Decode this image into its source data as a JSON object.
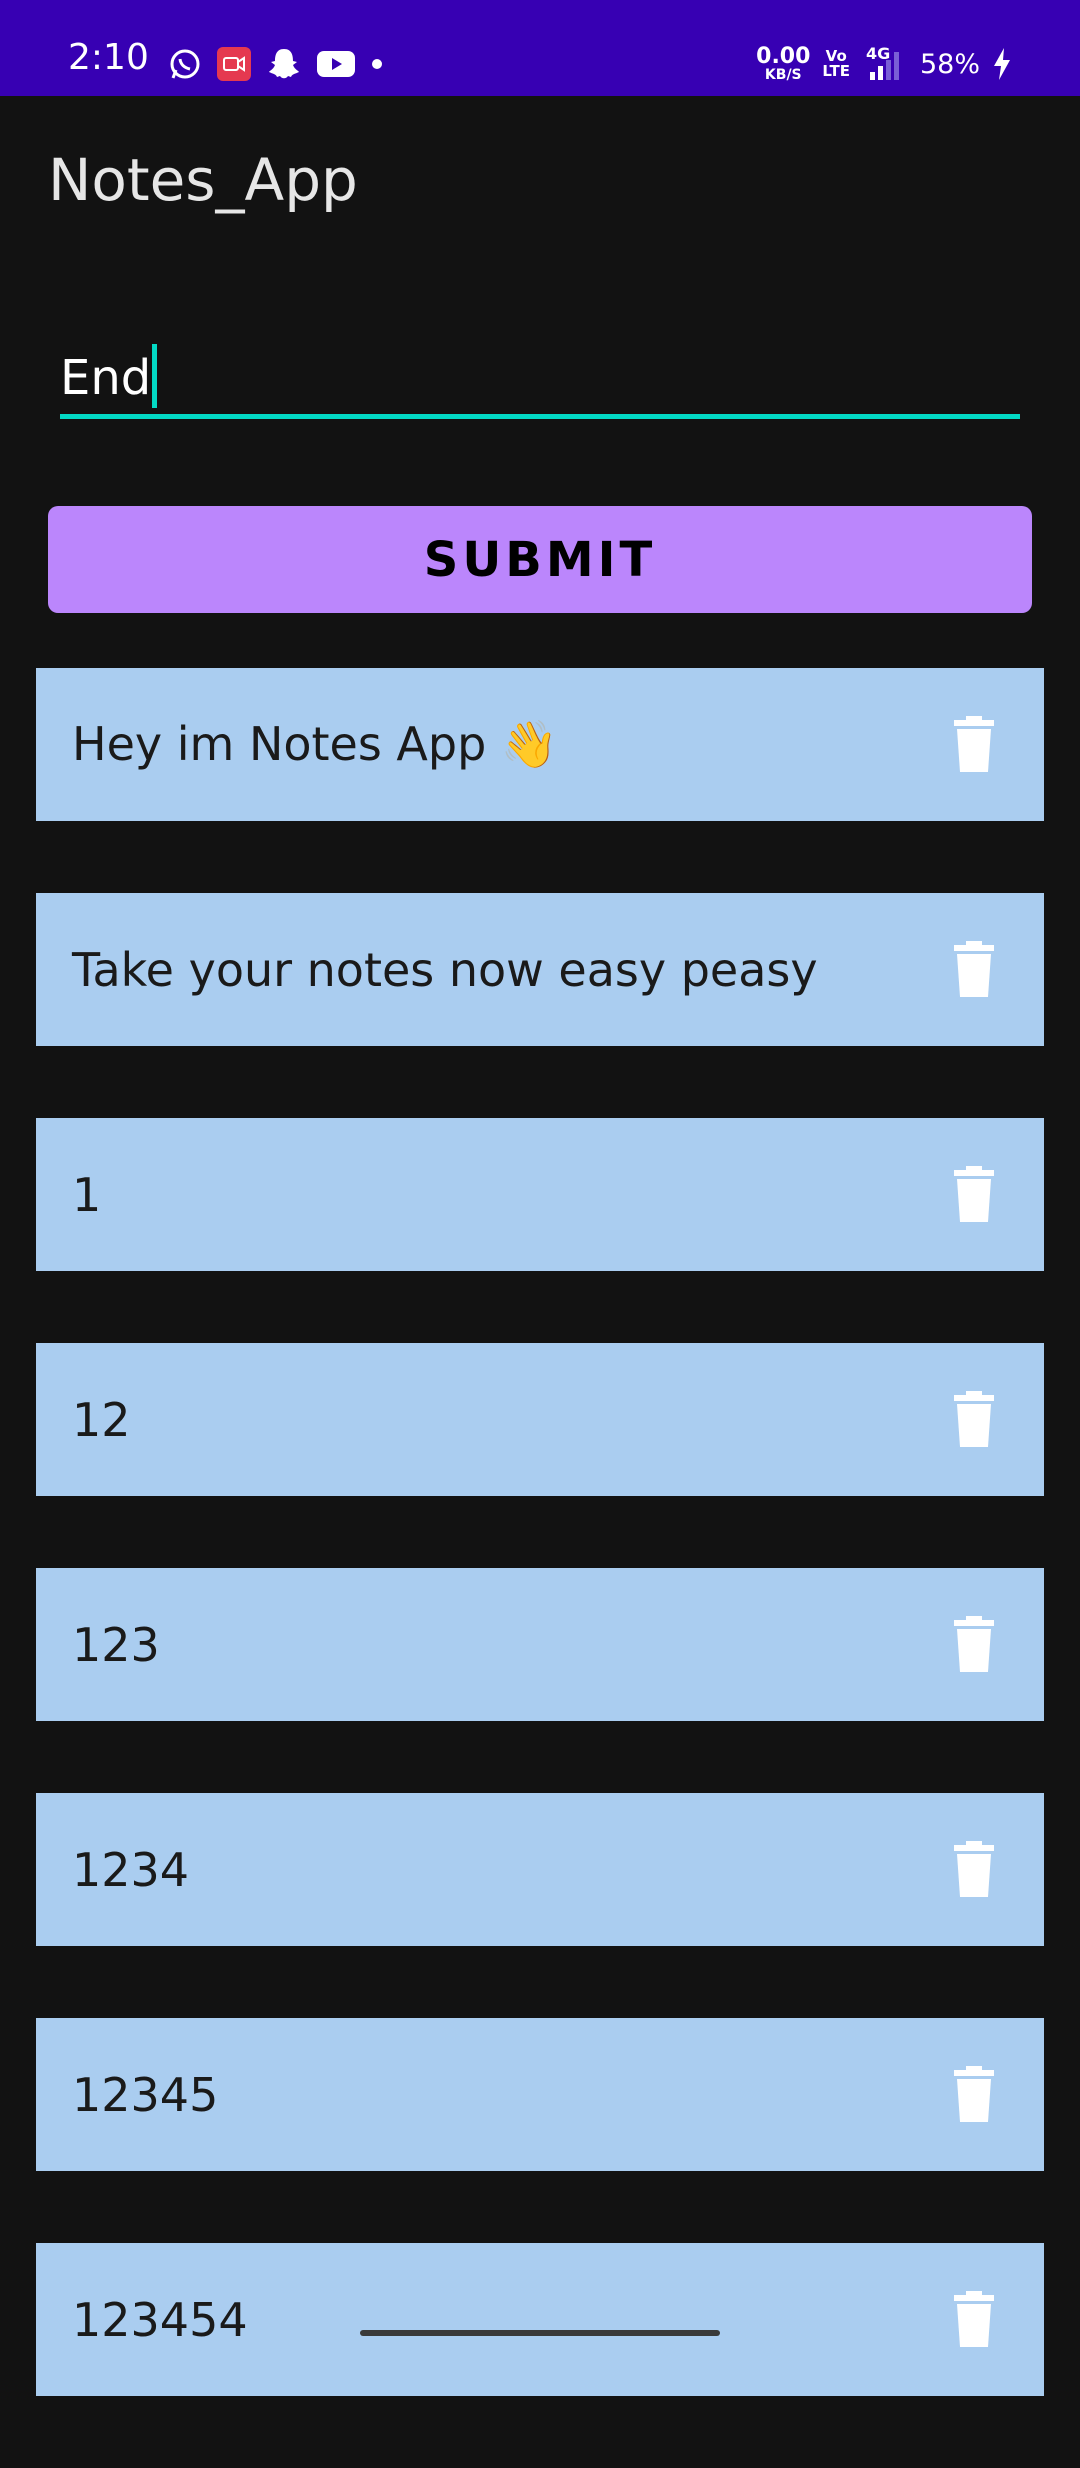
{
  "status_bar": {
    "time": "2:10",
    "net_speed_value": "0.00",
    "net_speed_unit": "KB/S",
    "volte_top": "Vo",
    "volte_bottom": "LTE",
    "network": "4G",
    "battery": "58%",
    "left_icons": [
      "whatsapp-icon",
      "screen-recorder-icon",
      "snapchat-icon",
      "youtube-icon",
      "dot-icon"
    ],
    "background_color": "#3700B3"
  },
  "app": {
    "title": "Notes_App"
  },
  "note_input": {
    "value": "End",
    "accent_color": "#03DAC5"
  },
  "submit": {
    "label": "SUBMIT",
    "color": "#BB86FC"
  },
  "notes": [
    {
      "text": "Hey im Notes App 👋",
      "icon": "trash-icon"
    },
    {
      "text": "Take your notes now easy peasy",
      "icon": "trash-icon"
    },
    {
      "text": "1",
      "icon": "trash-icon"
    },
    {
      "text": "12",
      "icon": "trash-icon"
    },
    {
      "text": "123",
      "icon": "trash-icon"
    },
    {
      "text": "1234",
      "icon": "trash-icon"
    },
    {
      "text": "12345",
      "icon": "trash-icon"
    },
    {
      "text": "123454",
      "icon": "trash-icon"
    }
  ],
  "colors": {
    "background": "#121212",
    "note_card": "#AACDF0"
  }
}
